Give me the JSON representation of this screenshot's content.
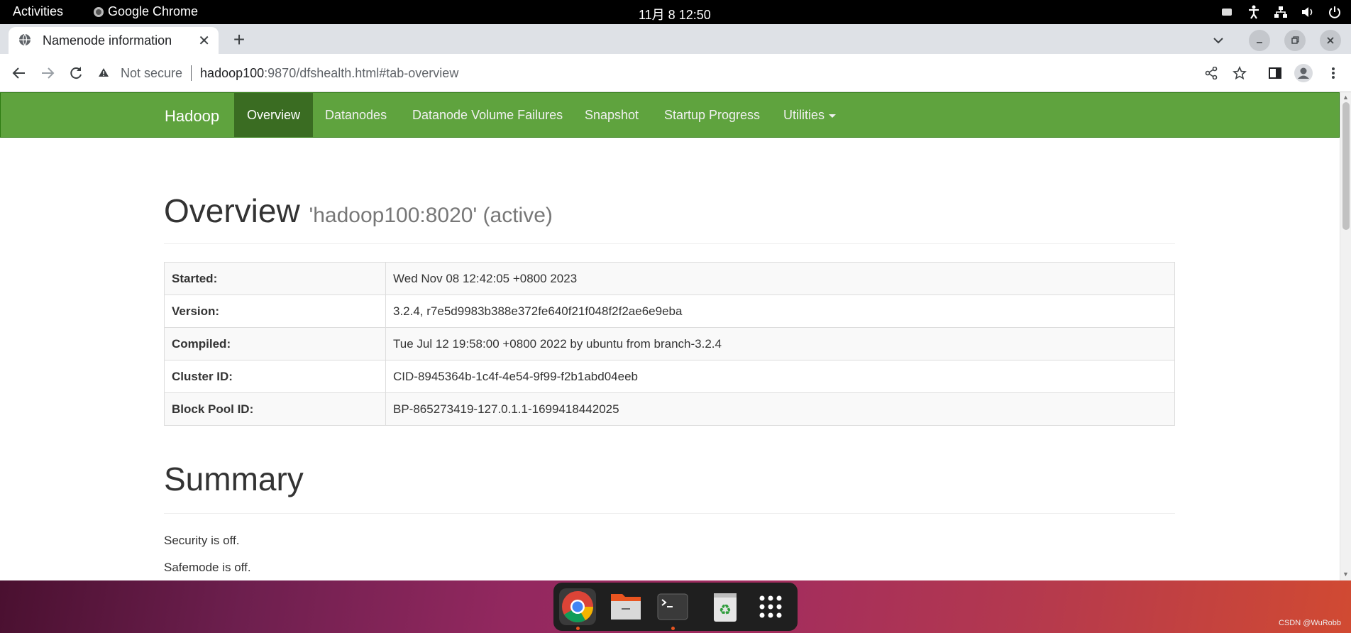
{
  "topbar": {
    "activities": "Activities",
    "app_name": "Google Chrome",
    "clock": "11月 8  12:50",
    "tray_icons": [
      "keyboard-icon",
      "accessibility-icon",
      "network-icon",
      "volume-icon",
      "power-icon"
    ]
  },
  "browser": {
    "tab_title": "Namenode information",
    "new_tab_label": "+",
    "url_security": "Not secure",
    "url_host": "hadoop100",
    "url_path": ":9870/dfshealth.html#tab-overview"
  },
  "navbar": {
    "brand": "Hadoop",
    "items": [
      {
        "label": "Overview",
        "active": true
      },
      {
        "label": "Datanodes"
      },
      {
        "label": "Datanode Volume Failures"
      },
      {
        "label": "Snapshot"
      },
      {
        "label": "Startup Progress"
      },
      {
        "label": "Utilities"
      }
    ],
    "color": "#5fa33e",
    "active_color": "#3a6c22"
  },
  "overview": {
    "heading": "Overview",
    "subheading": "'hadoop100:8020' (active)",
    "rows": [
      {
        "key": "Started:",
        "value": "Wed Nov 08 12:42:05 +0800 2023"
      },
      {
        "key": "Version:",
        "value": "3.2.4, r7e5d9983b388e372fe640f21f048f2f2ae6e9eba"
      },
      {
        "key": "Compiled:",
        "value": "Tue Jul 12 19:58:00 +0800 2022 by ubuntu from branch-3.2.4"
      },
      {
        "key": "Cluster ID:",
        "value": "CID-8945364b-1c4f-4e54-9f99-f2b1abd04eeb"
      },
      {
        "key": "Block Pool ID:",
        "value": "BP-865273419-127.0.1.1-1699418442025"
      }
    ]
  },
  "summary": {
    "heading": "Summary",
    "security": "Security is off.",
    "safemode": "Safemode is off."
  },
  "dock": {
    "apps": [
      "chrome-icon",
      "files-icon",
      "terminal-icon",
      "trash-icon",
      "app-grid-icon"
    ]
  },
  "watermark": "CSDN @WuRobb"
}
